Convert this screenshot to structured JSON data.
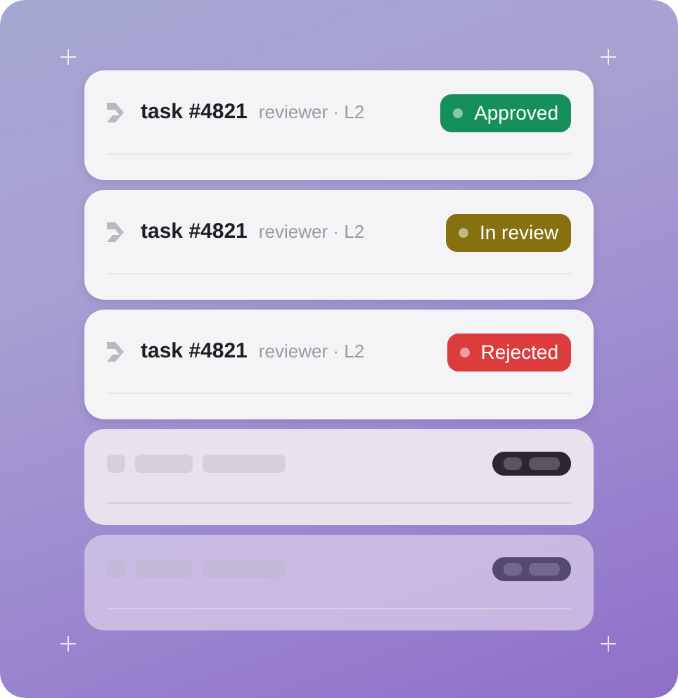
{
  "items": [
    {
      "kind": "task",
      "title": "task #4821",
      "meta": "reviewer · L2",
      "status": "Approved",
      "color": "#15905a"
    },
    {
      "kind": "task",
      "title": "task #4821",
      "meta": "reviewer · L2",
      "status": "In review",
      "color": "#86700f"
    },
    {
      "kind": "task",
      "title": "task #4821",
      "meta": "reviewer · L2",
      "status": "Rejected",
      "color": "#dc3c3c"
    },
    {
      "kind": "skeleton",
      "faded": false
    },
    {
      "kind": "skeleton",
      "faded": true
    }
  ]
}
